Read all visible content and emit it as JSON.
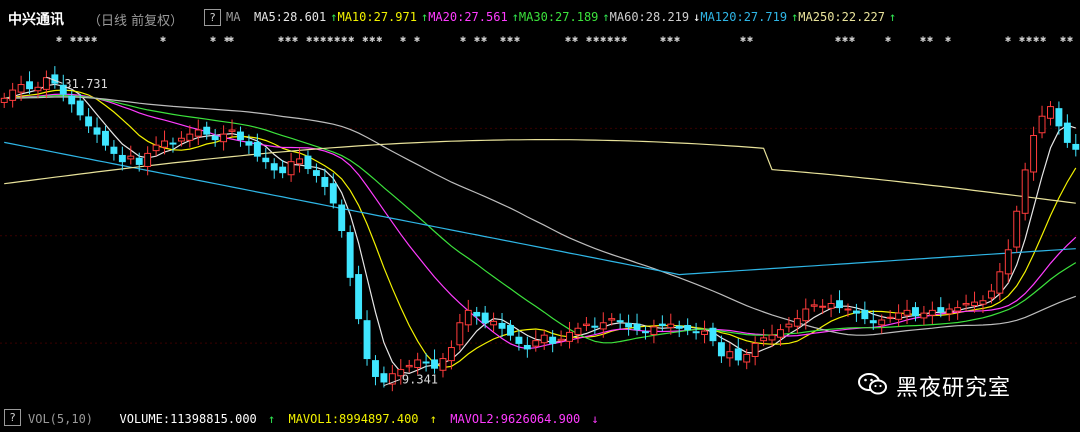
{
  "header": {
    "stock_name": "中兴通讯",
    "mode": "（日线 前复权）",
    "help_glyph": "?",
    "ma_label": "MA",
    "ma": [
      {
        "label": "MA5:28.601",
        "color": "#e6e6e6",
        "arrow": "↑"
      },
      {
        "label": "MA10:27.971",
        "color": "#f2f200",
        "arrow": "↑"
      },
      {
        "label": "MA20:27.561",
        "color": "#ff3cff",
        "arrow": "↑"
      },
      {
        "label": "MA30:27.189",
        "color": "#3ce23c",
        "arrow": "↑"
      },
      {
        "label": "MA60:28.219",
        "color": "#cfcfcf",
        "arrow": "↓"
      },
      {
        "label": "MA120:27.719",
        "color": "#2fb6e6",
        "arrow": "↑"
      },
      {
        "label": "MA250:22.227",
        "color": "#e8e29a",
        "arrow": "↑"
      }
    ],
    "arrow_colors": {
      "up": "#2fe24f",
      "down": "#ffffff"
    }
  },
  "signal_markers": {
    "glyph": "✱",
    "groups": [
      {
        "text": "✱ ✱✱✱✱"
      },
      {
        "text": "✱"
      },
      {
        "text": "✱ ✱"
      },
      {
        "text": "✱"
      },
      {
        "text": "✱✱✱ ✱✱✱✱✱✱✱ ✱✱✱"
      },
      {
        "text": "✱ ✱"
      },
      {
        "text": "✱ ✱✱"
      },
      {
        "text": "✱✱✱"
      },
      {
        "text": "✱✱ ✱✱✱✱✱✱"
      },
      {
        "text": "✱✱✱"
      },
      {
        "text": "✱✱"
      },
      {
        "text": "✱✱✱"
      },
      {
        "text": "✱"
      },
      {
        "text": "✱✱"
      },
      {
        "text": "✱"
      },
      {
        "text": "✱ ✱✱✱✱"
      },
      {
        "text": "✱✱"
      }
    ]
  },
  "chart_data": {
    "type": "candlestick",
    "high_annotation": "31.731",
    "low_annotation": "9.341",
    "ylim": [
      8,
      34
    ],
    "colors": {
      "up": "#ff3c3c",
      "down": "#40e6ff",
      "bg": "#000000",
      "grid": "#3a0000"
    },
    "closes": [
      30.2,
      30.8,
      31.2,
      30.9,
      31.0,
      31.7,
      31.3,
      30.5,
      29.8,
      29.0,
      28.2,
      27.6,
      26.8,
      26.2,
      25.6,
      26.0,
      25.4,
      26.2,
      26.8,
      27.1,
      26.9,
      27.3,
      27.6,
      27.9,
      27.6,
      27.2,
      27.6,
      27.9,
      27.2,
      26.8,
      26.0,
      25.6,
      25.0,
      24.8,
      25.6,
      25.8,
      25.1,
      24.6,
      23.8,
      22.6,
      20.6,
      17.2,
      14.2,
      11.3,
      10.0,
      9.6,
      10.2,
      10.5,
      10.8,
      11.2,
      11.0,
      10.6,
      11.3,
      12.1,
      13.9,
      14.8,
      14.4,
      13.9,
      14.0,
      13.5,
      13.0,
      12.4,
      12.0,
      12.6,
      13.0,
      12.4,
      12.7,
      13.2,
      13.5,
      13.8,
      13.6,
      13.9,
      14.2,
      14.0,
      13.6,
      13.4,
      13.2,
      13.6,
      13.7,
      13.8,
      13.5,
      13.4,
      13.2,
      13.3,
      12.6,
      11.5,
      11.8,
      11.2,
      11.6,
      12.4,
      12.8,
      13.0,
      13.4,
      13.8,
      14.2,
      14.9,
      15.2,
      15.1,
      15.3,
      15.0,
      14.9,
      14.6,
      14.2,
      13.9,
      14.1,
      14.3,
      14.6,
      14.8,
      14.4,
      14.6,
      14.8,
      14.7,
      14.9,
      15.0,
      15.3,
      15.4,
      15.5,
      16.2,
      17.6,
      19.2,
      22.0,
      25.0,
      27.5,
      28.9,
      29.6,
      28.2,
      27.0,
      26.5
    ],
    "ma_series": [
      {
        "name": "MA5",
        "period": 5,
        "color": "#e6e6e6"
      },
      {
        "name": "MA10",
        "period": 10,
        "color": "#f2f200"
      },
      {
        "name": "MA20",
        "period": 20,
        "color": "#ff3cff"
      },
      {
        "name": "MA30",
        "period": 30,
        "color": "#3ce23c"
      },
      {
        "name": "MA60",
        "period": 60,
        "color": "#bdbdbd"
      },
      {
        "name": "MA120",
        "period": 120,
        "color": "#2fb6e6"
      },
      {
        "name": "MA250",
        "period": 250,
        "color": "#e8e29a"
      }
    ]
  },
  "volume": {
    "label": "VOL(5,10)",
    "volume_text": "VOLUME:11398815.000",
    "volume_color": "#ffffff",
    "mavol1_text": "MAVOL1:8994897.400",
    "mavol1_color": "#f2f200",
    "mavol2_text": "MAVOL2:9626064.900",
    "mavol2_color": "#ff3cff",
    "arrows": [
      "↑",
      "↑",
      "↓"
    ]
  },
  "watermark": {
    "text": "黑夜研究室",
    "icon": "wechat-icon"
  }
}
